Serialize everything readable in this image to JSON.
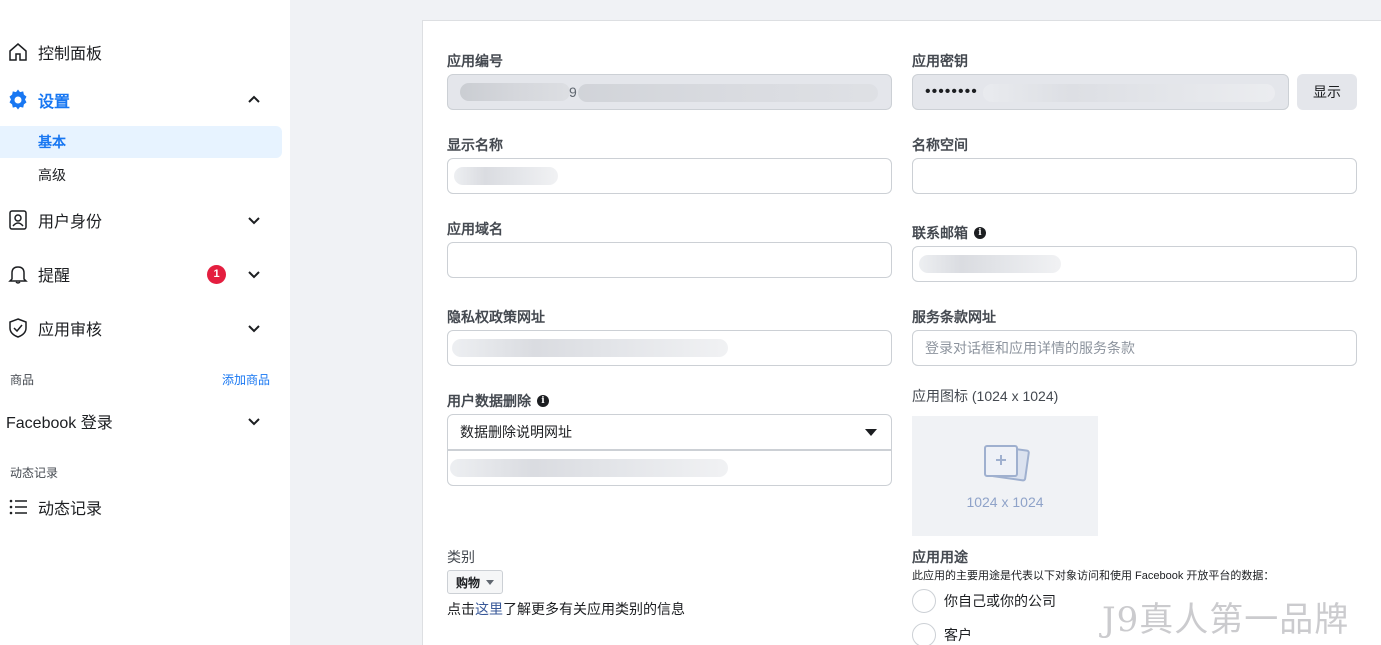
{
  "sidebar": {
    "dashboard": "控制面板",
    "settings": "设置",
    "settings_basic": "基本",
    "settings_advanced": "高级",
    "user_identity": "用户身份",
    "alerts": "提醒",
    "alerts_badge": "1",
    "app_review": "应用审核",
    "products_heading": "商品",
    "add_product": "添加商品",
    "facebook_login": "Facebook 登录",
    "activity_heading": "动态记录",
    "activity_log": "动态记录"
  },
  "form": {
    "app_id_label": "应用编号",
    "app_id_value_suffix": "9",
    "app_secret_label": "应用密钥",
    "app_secret_value": "••••••••",
    "show_button": "显示",
    "display_name_label": "显示名称",
    "namespace_label": "名称空间",
    "app_domains_label": "应用域名",
    "contact_email_label": "联系邮箱",
    "privacy_url_label": "隐私权政策网址",
    "tos_url_label": "服务条款网址",
    "tos_url_placeholder": "登录对话框和应用详情的服务条款",
    "data_deletion_label": "用户数据删除",
    "data_deletion_select": "数据删除说明网址",
    "app_icon_label": "应用图标 (1024 x 1024)",
    "app_icon_dim": "1024 x 1024",
    "category_label": "类别",
    "category_value": "购物",
    "category_help_prefix": "点击",
    "category_help_link": "这里",
    "category_help_suffix": "了解更多有关应用类别的信息",
    "purpose_label": "应用用途",
    "purpose_desc": "此应用的主要用途是代表以下对象访问和使用 Facebook 开放平台的数据：",
    "purpose_option_1": "你自己或你的公司",
    "purpose_option_2": "客户"
  },
  "watermark": "J9真人第一品牌",
  "colors": {
    "accent": "#1877f2",
    "badge": "#e41e3f"
  }
}
